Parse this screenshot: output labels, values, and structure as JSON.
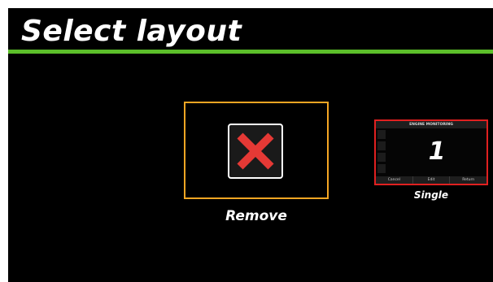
{
  "header": {
    "title": "Select layout",
    "accent_color": "#5cbf2a"
  },
  "options": {
    "remove": {
      "label": "Remove",
      "icon": "close-x-icon",
      "icon_color": "#e53935",
      "border_color": "#f5a623",
      "state": "highlighted"
    },
    "single": {
      "label": "Single",
      "border_color": "#e02020",
      "preview": {
        "header_text": "ENGINE MONITORING",
        "value": "1",
        "footer_buttons": [
          "Cancel",
          "Edit",
          "Return"
        ]
      }
    }
  }
}
